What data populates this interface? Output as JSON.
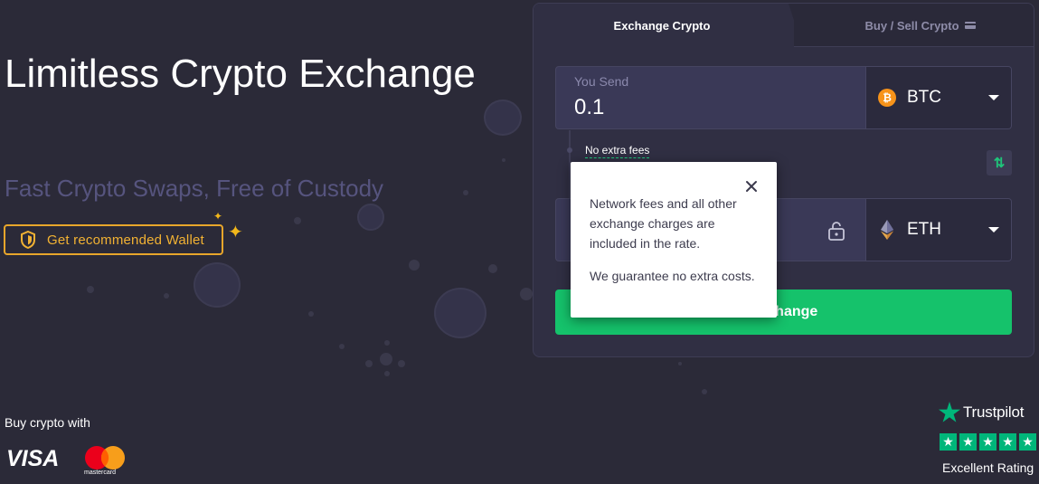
{
  "hero": {
    "title": "Limitless Crypto Exchange",
    "subtitle": "Fast Crypto Swaps, Free of Custody",
    "wallet_button": "Get recommended Wallet"
  },
  "payment": {
    "label": "Buy crypto with",
    "visa": "VISA",
    "mastercard": "mastercard"
  },
  "trustpilot": {
    "name": "Trustpilot",
    "rating_text": "Excellent Rating",
    "stars": 5
  },
  "widget": {
    "tabs": [
      {
        "label": "Exchange Crypto",
        "active": true
      },
      {
        "label": "Buy / Sell Crypto",
        "active": false
      }
    ],
    "send": {
      "label": "You Send",
      "value": "0.1",
      "currency": "BTC"
    },
    "get": {
      "currency": "ETH"
    },
    "fees_link": "No extra fees",
    "exchange_button": "Exchange"
  },
  "tooltip": {
    "line1": "Network fees and all other exchange charges are included in the rate.",
    "line2": "We guarantee no extra costs."
  },
  "colors": {
    "background": "#2b2a38",
    "accent_green": "#15c26b",
    "wallet_yellow": "#f2b233",
    "subtitle": "#56547e",
    "btc": "#f7931a",
    "trustpilot": "#00b67a"
  }
}
